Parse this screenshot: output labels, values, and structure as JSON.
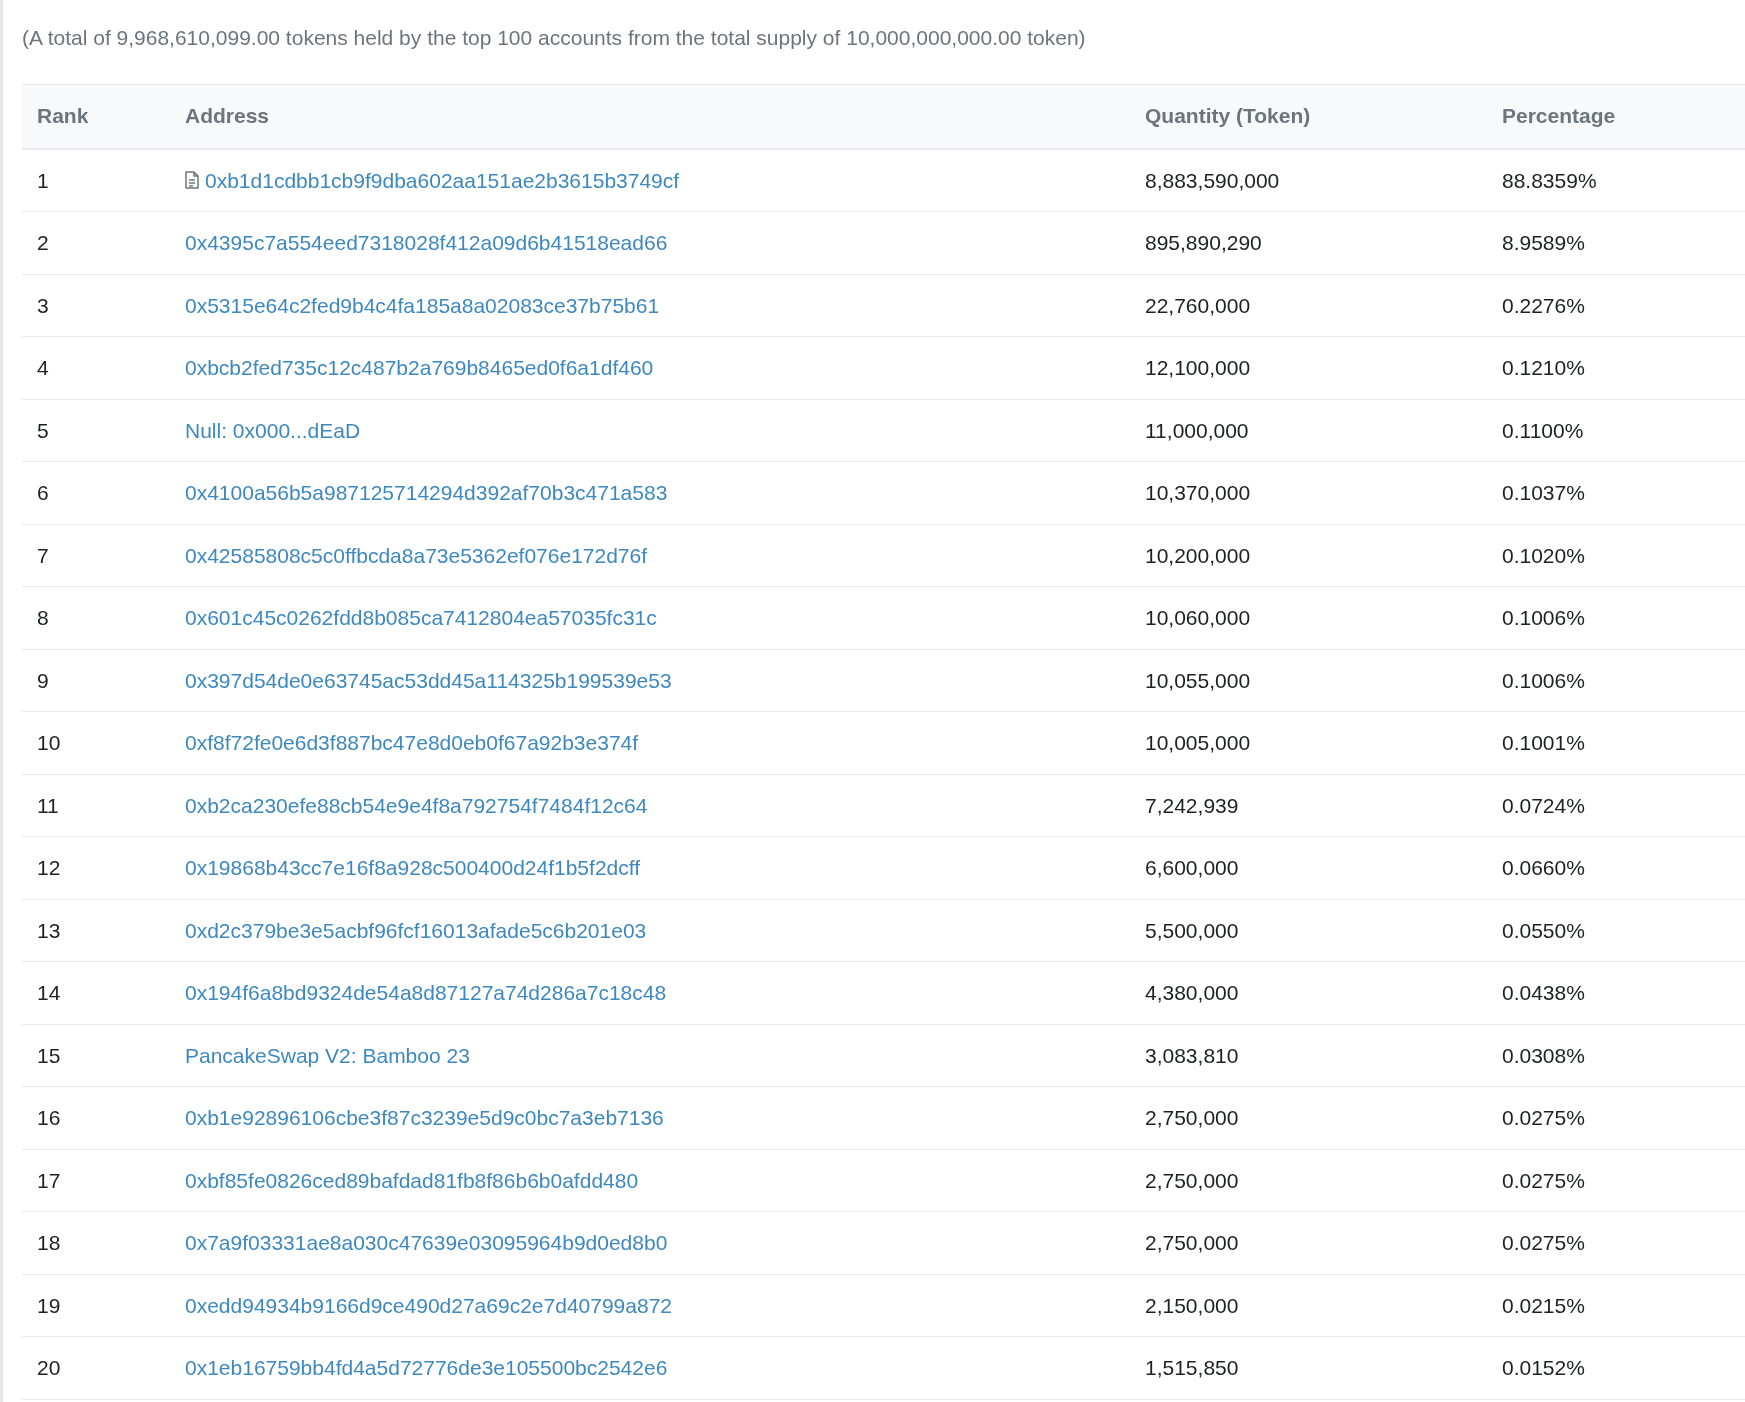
{
  "summary": "(A total of 9,968,610,099.00 tokens held by the top 100 accounts from the total supply of 10,000,000,000.00 token)",
  "table": {
    "columns": [
      "Rank",
      "Address",
      "Quantity (Token)",
      "Percentage"
    ],
    "rows": [
      {
        "rank": "1",
        "address": "0xb1d1cdbb1cb9f9dba602aa151ae2b3615b3749cf",
        "contract": true,
        "quantity": "8,883,590,000",
        "percentage": "88.8359%"
      },
      {
        "rank": "2",
        "address": "0x4395c7a554eed7318028f412a09d6b41518ead66",
        "contract": false,
        "quantity": "895,890,290",
        "percentage": "8.9589%"
      },
      {
        "rank": "3",
        "address": "0x5315e64c2fed9b4c4fa185a8a02083ce37b75b61",
        "contract": false,
        "quantity": "22,760,000",
        "percentage": "0.2276%"
      },
      {
        "rank": "4",
        "address": "0xbcb2fed735c12c487b2a769b8465ed0f6a1df460",
        "contract": false,
        "quantity": "12,100,000",
        "percentage": "0.1210%"
      },
      {
        "rank": "5",
        "address": "Null: 0x000...dEaD",
        "contract": false,
        "quantity": "11,000,000",
        "percentage": "0.1100%"
      },
      {
        "rank": "6",
        "address": "0x4100a56b5a987125714294d392af70b3c471a583",
        "contract": false,
        "quantity": "10,370,000",
        "percentage": "0.1037%"
      },
      {
        "rank": "7",
        "address": "0x42585808c5c0ffbcda8a73e5362ef076e172d76f",
        "contract": false,
        "quantity": "10,200,000",
        "percentage": "0.1020%"
      },
      {
        "rank": "8",
        "address": "0x601c45c0262fdd8b085ca7412804ea57035fc31c",
        "contract": false,
        "quantity": "10,060,000",
        "percentage": "0.1006%"
      },
      {
        "rank": "9",
        "address": "0x397d54de0e63745ac53dd45a114325b199539e53",
        "contract": false,
        "quantity": "10,055,000",
        "percentage": "0.1006%"
      },
      {
        "rank": "10",
        "address": "0xf8f72fe0e6d3f887bc47e8d0eb0f67a92b3e374f",
        "contract": false,
        "quantity": "10,005,000",
        "percentage": "0.1001%"
      },
      {
        "rank": "11",
        "address": "0xb2ca230efe88cb54e9e4f8a792754f7484f12c64",
        "contract": false,
        "quantity": "7,242,939",
        "percentage": "0.0724%"
      },
      {
        "rank": "12",
        "address": "0x19868b43cc7e16f8a928c500400d24f1b5f2dcff",
        "contract": false,
        "quantity": "6,600,000",
        "percentage": "0.0660%"
      },
      {
        "rank": "13",
        "address": "0xd2c379be3e5acbf96fcf16013afade5c6b201e03",
        "contract": false,
        "quantity": "5,500,000",
        "percentage": "0.0550%"
      },
      {
        "rank": "14",
        "address": "0x194f6a8bd9324de54a8d87127a74d286a7c18c48",
        "contract": false,
        "quantity": "4,380,000",
        "percentage": "0.0438%"
      },
      {
        "rank": "15",
        "address": "PancakeSwap V2: Bamboo 23",
        "contract": false,
        "quantity": "3,083,810",
        "percentage": "0.0308%"
      },
      {
        "rank": "16",
        "address": "0xb1e92896106cbe3f87c3239e5d9c0bc7a3eb7136",
        "contract": false,
        "quantity": "2,750,000",
        "percentage": "0.0275%"
      },
      {
        "rank": "17",
        "address": "0xbf85fe0826ced89bafdad81fb8f86b6b0afdd480",
        "contract": false,
        "quantity": "2,750,000",
        "percentage": "0.0275%"
      },
      {
        "rank": "18",
        "address": "0x7a9f03331ae8a030c47639e03095964b9d0ed8b0",
        "contract": false,
        "quantity": "2,750,000",
        "percentage": "0.0275%"
      },
      {
        "rank": "19",
        "address": "0xedd94934b9166d9ce490d27a69c2e7d40799a872",
        "contract": false,
        "quantity": "2,150,000",
        "percentage": "0.0215%"
      },
      {
        "rank": "20",
        "address": "0x1eb16759bb4fd4a5d72776de3e105500bc2542e6",
        "contract": false,
        "quantity": "1,515,850",
        "percentage": "0.0152%"
      }
    ]
  }
}
